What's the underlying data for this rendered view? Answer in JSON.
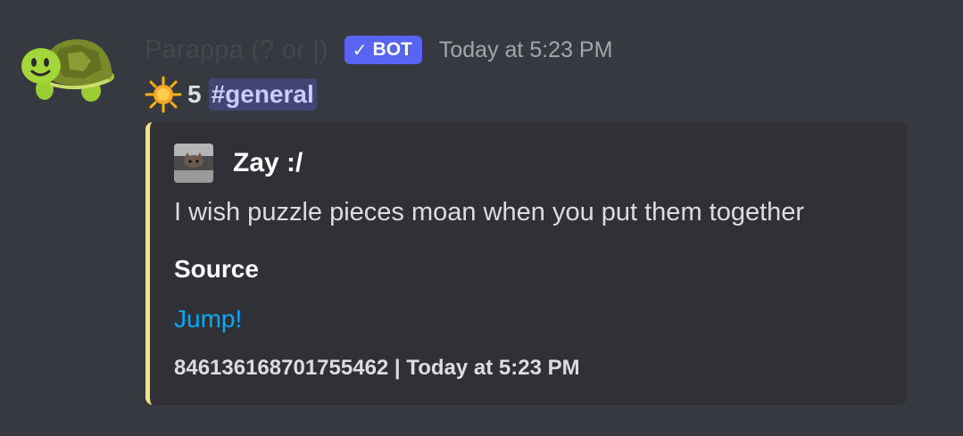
{
  "message": {
    "author": "Parappa (? or |)",
    "bot_tag": {
      "check": "✓",
      "label": "BOT",
      "color": "#5865f2"
    },
    "timestamp": "Today at 5:23 PM",
    "avatar_icon": "turtle-icon",
    "content": {
      "star_icon": "glowing-star-icon",
      "star_count": "5",
      "channel_mention": "#general"
    }
  },
  "embed": {
    "accent_color": "#ffe082",
    "author_icon": "cat-avatar-icon",
    "author_name": "Zay :/",
    "description": "I wish puzzle pieces moan when you put them together",
    "field": {
      "name": "Source",
      "value": "Jump!"
    },
    "footer": "846136168701755462 | Today at 5:23 PM"
  }
}
